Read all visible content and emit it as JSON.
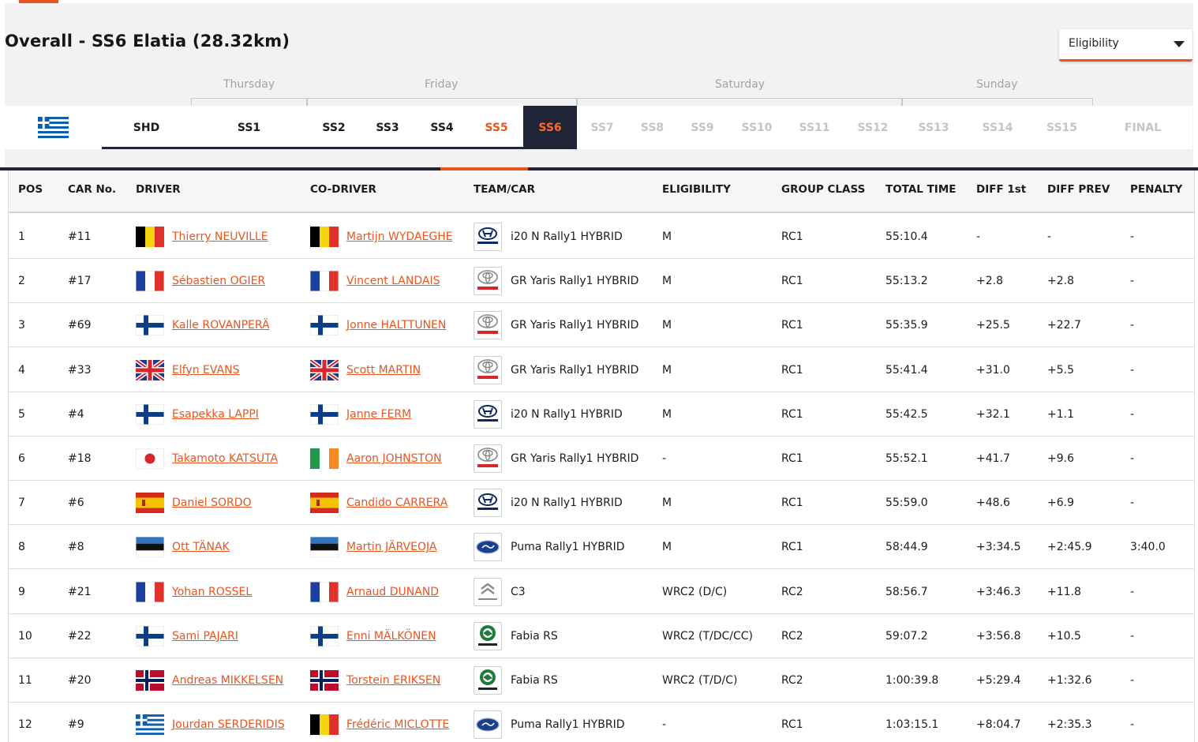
{
  "header": {
    "title": "Overall - SS6 Elatia (28.32km)",
    "eligibility_select": "Eligibility"
  },
  "days": [
    {
      "label": "Thursday"
    },
    {
      "label": "Friday"
    },
    {
      "label": "Saturday"
    },
    {
      "label": "Sunday"
    }
  ],
  "stages": [
    {
      "label": "SHD",
      "state": "done"
    },
    {
      "label": "SS1",
      "state": "done"
    },
    {
      "label": "SS2",
      "state": "done"
    },
    {
      "label": "SS3",
      "state": "done"
    },
    {
      "label": "SS4",
      "state": "done"
    },
    {
      "label": "SS5",
      "state": "prev"
    },
    {
      "label": "SS6",
      "state": "active"
    },
    {
      "label": "SS7",
      "state": "future"
    },
    {
      "label": "SS8",
      "state": "future"
    },
    {
      "label": "SS9",
      "state": "future"
    },
    {
      "label": "SS10",
      "state": "future"
    },
    {
      "label": "SS11",
      "state": "future"
    },
    {
      "label": "SS12",
      "state": "future"
    },
    {
      "label": "SS13",
      "state": "future"
    },
    {
      "label": "SS14",
      "state": "future"
    },
    {
      "label": "SS15",
      "state": "future"
    },
    {
      "label": "FINAL",
      "state": "future"
    }
  ],
  "columns": [
    "POS",
    "CAR No.",
    "DRIVER",
    "CO-DRIVER",
    "TEAM/CAR",
    "ELIGIBILITY",
    "GROUP CLASS",
    "TOTAL TIME",
    "DIFF 1st",
    "DIFF PREV",
    "PENALTY"
  ],
  "colors": {
    "accent": "#e8551f",
    "navy": "#1f2536"
  },
  "rows": [
    {
      "pos": "1",
      "car": "#11",
      "driver": "Thierry NEUVILLE",
      "driver_flag": "belgium-flag",
      "codriver": "Martijn WYDAEGHE",
      "codriver_flag": "belgium-flag",
      "team_logo": "hyundai-logo",
      "car_model": "i20 N Rally1 HYBRID",
      "eligibility": "M",
      "group": "RC1",
      "total": "55:10.4",
      "diff1": "-",
      "diffprev": "-",
      "penalty": "-"
    },
    {
      "pos": "2",
      "car": "#17",
      "driver": "Sébastien OGIER",
      "driver_flag": "france-flag",
      "codriver": "Vincent LANDAIS",
      "codriver_flag": "france-flag",
      "team_logo": "toyota-logo",
      "car_model": "GR Yaris Rally1 HYBRID",
      "eligibility": "M",
      "group": "RC1",
      "total": "55:13.2",
      "diff1": "+2.8",
      "diffprev": "+2.8",
      "penalty": "-"
    },
    {
      "pos": "3",
      "car": "#69",
      "driver": "Kalle ROVANPERÄ",
      "driver_flag": "finland-flag",
      "codriver": "Jonne HALTTUNEN",
      "codriver_flag": "finland-flag",
      "team_logo": "toyota-logo",
      "car_model": "GR Yaris Rally1 HYBRID",
      "eligibility": "M",
      "group": "RC1",
      "total": "55:35.9",
      "diff1": "+25.5",
      "diffprev": "+22.7",
      "penalty": "-"
    },
    {
      "pos": "4",
      "car": "#33",
      "driver": "Elfyn EVANS",
      "driver_flag": "uk-flag",
      "codriver": "Scott MARTIN",
      "codriver_flag": "uk-flag",
      "team_logo": "toyota-logo",
      "car_model": "GR Yaris Rally1 HYBRID",
      "eligibility": "M",
      "group": "RC1",
      "total": "55:41.4",
      "diff1": "+31.0",
      "diffprev": "+5.5",
      "penalty": "-"
    },
    {
      "pos": "5",
      "car": "#4",
      "driver": "Esapekka LAPPI",
      "driver_flag": "finland-flag",
      "codriver": "Janne FERM",
      "codriver_flag": "finland-flag",
      "team_logo": "hyundai-logo",
      "car_model": "i20 N Rally1 HYBRID",
      "eligibility": "M",
      "group": "RC1",
      "total": "55:42.5",
      "diff1": "+32.1",
      "diffprev": "+1.1",
      "penalty": "-"
    },
    {
      "pos": "6",
      "car": "#18",
      "driver": "Takamoto KATSUTA",
      "driver_flag": "japan-flag",
      "codriver": "Aaron JOHNSTON",
      "codriver_flag": "ireland-flag",
      "team_logo": "toyota-logo",
      "car_model": "GR Yaris Rally1 HYBRID",
      "eligibility": "-",
      "group": "RC1",
      "total": "55:52.1",
      "diff1": "+41.7",
      "diffprev": "+9.6",
      "penalty": "-"
    },
    {
      "pos": "7",
      "car": "#6",
      "driver": "Daniel SORDO",
      "driver_flag": "spain-flag",
      "codriver": "Candido CARRERA",
      "codriver_flag": "spain-flag",
      "team_logo": "hyundai-logo",
      "car_model": "i20 N Rally1 HYBRID",
      "eligibility": "M",
      "group": "RC1",
      "total": "55:59.0",
      "diff1": "+48.6",
      "diffprev": "+6.9",
      "penalty": "-"
    },
    {
      "pos": "8",
      "car": "#8",
      "driver": "Ott TÄNAK",
      "driver_flag": "estonia-flag",
      "codriver": "Martin JÄRVEOJA",
      "codriver_flag": "estonia-flag",
      "team_logo": "ford-logo",
      "car_model": "Puma Rally1 HYBRID",
      "eligibility": "M",
      "group": "RC1",
      "total": "58:44.9",
      "diff1": "+3:34.5",
      "diffprev": "+2:45.9",
      "penalty": "3:40.0"
    },
    {
      "pos": "9",
      "car": "#21",
      "driver": "Yohan ROSSEL",
      "driver_flag": "france-flag",
      "codriver": "Arnaud DUNAND",
      "codriver_flag": "france-flag",
      "team_logo": "citroen-logo",
      "car_model": "C3",
      "eligibility": "WRC2 (D/C)",
      "group": "RC2",
      "total": "58:56.7",
      "diff1": "+3:46.3",
      "diffprev": "+11.8",
      "penalty": "-"
    },
    {
      "pos": "10",
      "car": "#22",
      "driver": "Sami PAJARI",
      "driver_flag": "finland-flag",
      "codriver": "Enni MÄLKÖNEN",
      "codriver_flag": "finland-flag",
      "team_logo": "skoda-logo",
      "car_model": "Fabia RS",
      "eligibility": "WRC2 (T/DC/CC)",
      "group": "RC2",
      "total": "59:07.2",
      "diff1": "+3:56.8",
      "diffprev": "+10.5",
      "penalty": "-"
    },
    {
      "pos": "11",
      "car": "#20",
      "driver": "Andreas MIKKELSEN",
      "driver_flag": "norway-flag",
      "codriver": "Torstein ERIKSEN",
      "codriver_flag": "norway-flag",
      "team_logo": "skoda-logo",
      "car_model": "Fabia RS",
      "eligibility": "WRC2 (T/D/C)",
      "group": "RC2",
      "total": "1:00:39.8",
      "diff1": "+5:29.4",
      "diffprev": "+1:32.6",
      "penalty": "-"
    },
    {
      "pos": "12",
      "car": "#9",
      "driver": "Jourdan SERDERIDIS",
      "driver_flag": "greece-flag",
      "codriver": "Frédéric MICLOTTE",
      "codriver_flag": "belgium-flag",
      "team_logo": "ford-logo",
      "car_model": "Puma Rally1 HYBRID",
      "eligibility": "-",
      "group": "RC1",
      "total": "1:03:15.1",
      "diff1": "+8:04.7",
      "diffprev": "+2:35.3",
      "penalty": "-"
    }
  ]
}
